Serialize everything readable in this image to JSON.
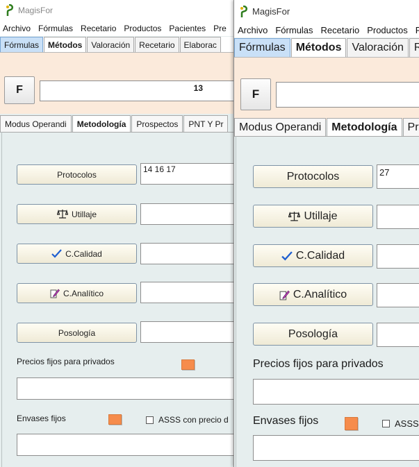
{
  "back_window": {
    "title": "MagisFor",
    "menu": [
      "Archivo",
      "Fórmulas",
      "Recetario",
      "Productos",
      "Pacientes",
      "Pre"
    ],
    "tabs": [
      "Fórmulas",
      "Métodos",
      "Valoración",
      "Recetario",
      "Elaborac"
    ],
    "f_label": "F",
    "code_value": "13",
    "subtabs": [
      "Modus Operandi",
      "Metodología",
      "Prospectos",
      "PNT Y Pr"
    ],
    "protocolos_label": "Protocolos",
    "protocolos_value": "14 16 17",
    "utillaje_label": "Utillaje",
    "calidad_label": "C.Calidad",
    "analitico_label": "C.Analítico",
    "posologia_label": "Posología",
    "precios_label": "Precios fijos para privados",
    "envases_label": "Envases fijos",
    "asss_label": "ASSS con precio d"
  },
  "front_window": {
    "title": "MagisFor",
    "menu": [
      "Archivo",
      "Fórmulas",
      "Recetario",
      "Productos",
      "Pa"
    ],
    "tabs": [
      "Fórmulas",
      "Métodos",
      "Valoración",
      "R"
    ],
    "f_label": "F",
    "subtabs": [
      "Modus Operandi",
      "Metodología",
      "Pr"
    ],
    "protocolos_label": "Protocolos",
    "protocolos_value": "27",
    "utillaje_label": "Utillaje",
    "calidad_label": "C.Calidad",
    "analitico_label": "C.Analítico",
    "posologia_label": "Posología",
    "precios_label": "Precios fijos para privados",
    "envases_label": "Envases fijos",
    "asss_label": "ASSS"
  },
  "icons": {
    "app": "magisfor-logo-icon",
    "utillaje": "scale-icon",
    "calidad": "checkmark-icon",
    "analitico": "pencil-icon"
  },
  "colors": {
    "panel_bg": "#e6eeee",
    "header_bg": "#fbeadb",
    "tab_highlight": "#c9e0f7",
    "orange_marker": "#f68c4c",
    "check_blue": "#1f5fd0"
  }
}
